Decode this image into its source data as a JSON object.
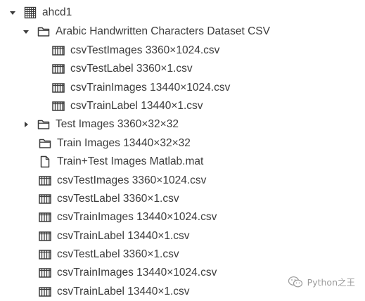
{
  "tree": {
    "root": {
      "label": "ahcd1",
      "icon": "dataset-grid-icon",
      "expanded": true
    },
    "folder": {
      "label": "Arabic Handwritten Characters Dataset CSV",
      "icon": "folder-icon",
      "expanded": true
    },
    "folder_children": [
      {
        "label": "csvTestImages 3360×1024.csv",
        "icon": "table-icon"
      },
      {
        "label": "csvTestLabel 3360×1.csv",
        "icon": "table-icon"
      },
      {
        "label": "csvTrainImages 13440×1024.csv",
        "icon": "table-icon"
      },
      {
        "label": "csvTrainLabel 13440×1.csv",
        "icon": "table-icon"
      }
    ],
    "root_children": [
      {
        "label": "Test Images 3360×32×32",
        "icon": "folder-icon",
        "collapsed": true
      },
      {
        "label": "Train Images 13440×32×32",
        "icon": "folder-icon"
      },
      {
        "label": "Train+Test Images Matlab.mat",
        "icon": "file-icon"
      },
      {
        "label": "csvTestImages 3360×1024.csv",
        "icon": "table-icon"
      },
      {
        "label": "csvTestLabel 3360×1.csv",
        "icon": "table-icon"
      },
      {
        "label": "csvTrainImages 13440×1024.csv",
        "icon": "table-icon"
      },
      {
        "label": "csvTrainLabel 13440×1.csv",
        "icon": "table-icon"
      },
      {
        "label": "csvTestLabel 3360×1.csv",
        "icon": "table-icon"
      },
      {
        "label": "csvTrainImages 13440×1024.csv",
        "icon": "table-icon"
      },
      {
        "label": "csvTrainLabel 13440×1.csv",
        "icon": "table-icon"
      }
    ]
  },
  "watermark": {
    "text": "Python之王",
    "icon": "wechat-icon"
  },
  "colors": {
    "text": "#3c3c3c",
    "icon": "#3c3c3c",
    "watermark": "#9a9a9a"
  }
}
